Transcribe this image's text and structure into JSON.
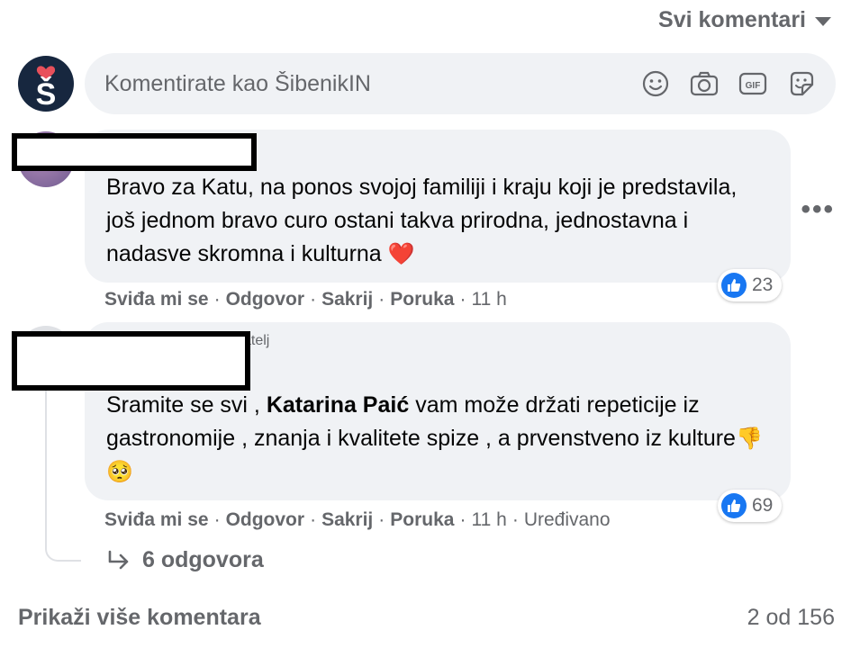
{
  "header": {
    "sort_label": "Svi komentari",
    "sort_icon": "caret-down-icon"
  },
  "composer": {
    "placeholder": "Komentirate kao ŠibenikIN",
    "avatar_letter": "Š",
    "tools": [
      "emoji-icon",
      "camera-icon",
      "gif-icon",
      "sticker-icon"
    ],
    "gif_label": "GIF"
  },
  "comments": [
    {
      "text": "Bravo za Katu, na ponos svojoj familiji i kraju koji je predstavila, još jednom bravo curo ostani takva prirodna, jednostavna i nadasve skromna i kulturna",
      "emoji": "❤️",
      "like_count": "23",
      "actions": {
        "like": "Sviđa mi se",
        "reply": "Odgovor",
        "hide": "Sakrij",
        "message": "Poruka",
        "time": "11 h"
      }
    },
    {
      "role_fragment": "atelj",
      "text_before": "Sramite se svi ,",
      "mention": "Katarina Paić",
      "text_after": "vam može držati repeticije iz gastronomije , znanja i kvalitete spize , a prvenstveno iz kulture",
      "emoji": "👎🥺",
      "like_count": "69",
      "actions": {
        "like": "Sviđa mi se",
        "reply": "Odgovor",
        "hide": "Sakrij",
        "message": "Poruka",
        "time": "11 h",
        "edited": "Uređivano"
      },
      "replies_label": "6 odgovora"
    }
  ],
  "footer": {
    "show_more": "Prikaži više komentara",
    "page_count": "2 od 156"
  },
  "colors": {
    "bubble": "#f0f2f5",
    "secondary_text": "#65676b",
    "like_blue": "#1877f2",
    "heart_red": "#e41e3f"
  }
}
